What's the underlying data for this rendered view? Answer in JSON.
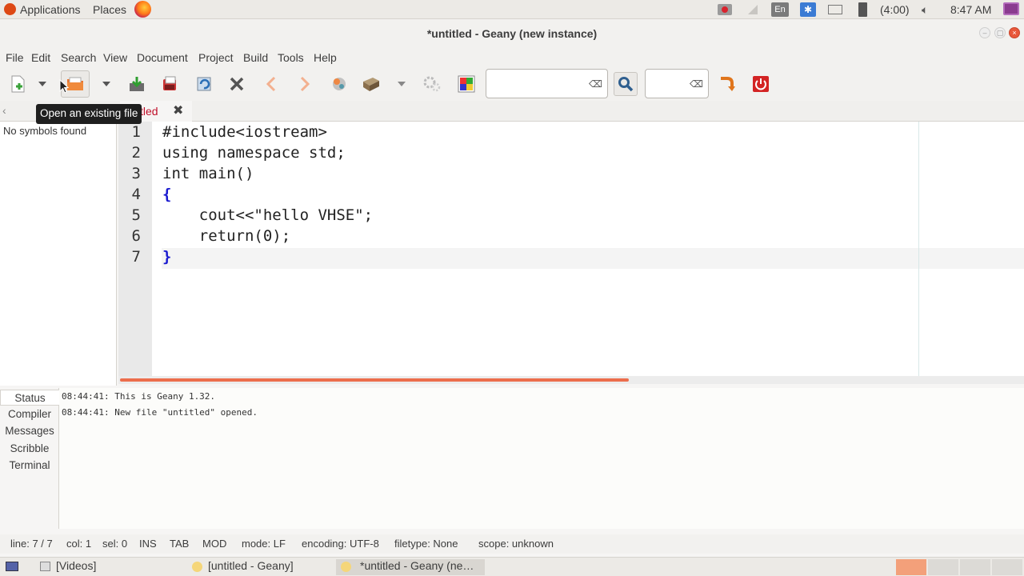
{
  "top_panel": {
    "applications": "Applications",
    "places": "Places",
    "lang": "En",
    "battery": "(4:00)",
    "clock": "8:47 AM"
  },
  "window": {
    "title": "*untitled - Geany (new instance)"
  },
  "menu": [
    "File",
    "Edit",
    "Search",
    "View",
    "Document",
    "Project",
    "Build",
    "Tools",
    "Help"
  ],
  "tooltip": "Open an existing file",
  "tab": {
    "label": "tled"
  },
  "sidebar": {
    "text": "No symbols found"
  },
  "editor": {
    "line_numbers": [
      "1",
      "2",
      "3",
      "4",
      "5",
      "6",
      "7"
    ],
    "lines": [
      "#include<iostream>",
      "using namespace std;",
      "int main()",
      "{",
      "    cout<<\"hello VHSE\";",
      "    return(0);",
      "}"
    ]
  },
  "messages": {
    "tabs": [
      "Status",
      "Compiler",
      "Messages",
      "Scribble",
      "Terminal"
    ],
    "lines": [
      "08:44:41: This is Geany 1.32.",
      "08:44:41: New file \"untitled\" opened."
    ]
  },
  "status_bar": {
    "line": "line: 7 / 7",
    "col": "col: 1",
    "sel": "sel: 0",
    "ins": "INS",
    "tab": "TAB",
    "mod": "MOD",
    "mode": "mode: LF",
    "encoding": "encoding: UTF-8",
    "filetype": "filetype: None",
    "scope": "scope: unknown"
  },
  "taskbar": {
    "items": [
      "[Videos]",
      "[untitled - Geany]",
      "*untitled - Geany (ne…"
    ]
  },
  "colors": {
    "accent": "#ec6d4c",
    "brace": "#1a1ad0",
    "tab_red": "#c0102a"
  }
}
